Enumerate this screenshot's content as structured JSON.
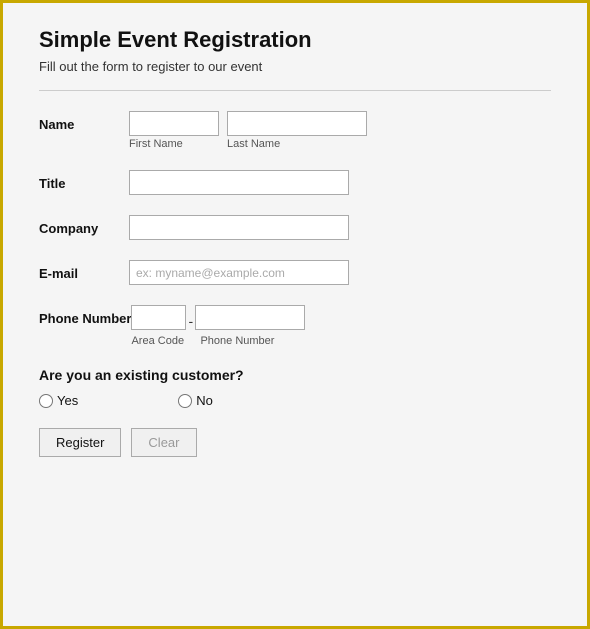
{
  "page": {
    "title": "Simple Event Registration",
    "subtitle": "Fill out the form to register to our event"
  },
  "form": {
    "name_label": "Name",
    "first_name_placeholder": "",
    "last_name_placeholder": "",
    "first_name_sublabel": "First Name",
    "last_name_sublabel": "Last Name",
    "title_label": "Title",
    "title_placeholder": "",
    "company_label": "Company",
    "company_placeholder": "",
    "email_label": "E-mail",
    "email_placeholder": "ex: myname@example.com",
    "phone_label": "Phone Number",
    "area_code_placeholder": "",
    "phone_placeholder": "",
    "area_code_sublabel": "Area Code",
    "phone_sublabel": "Phone Number",
    "customer_question": "Are you an existing customer?",
    "yes_label": "Yes",
    "no_label": "No",
    "register_btn": "Register",
    "clear_btn": "Clear"
  }
}
